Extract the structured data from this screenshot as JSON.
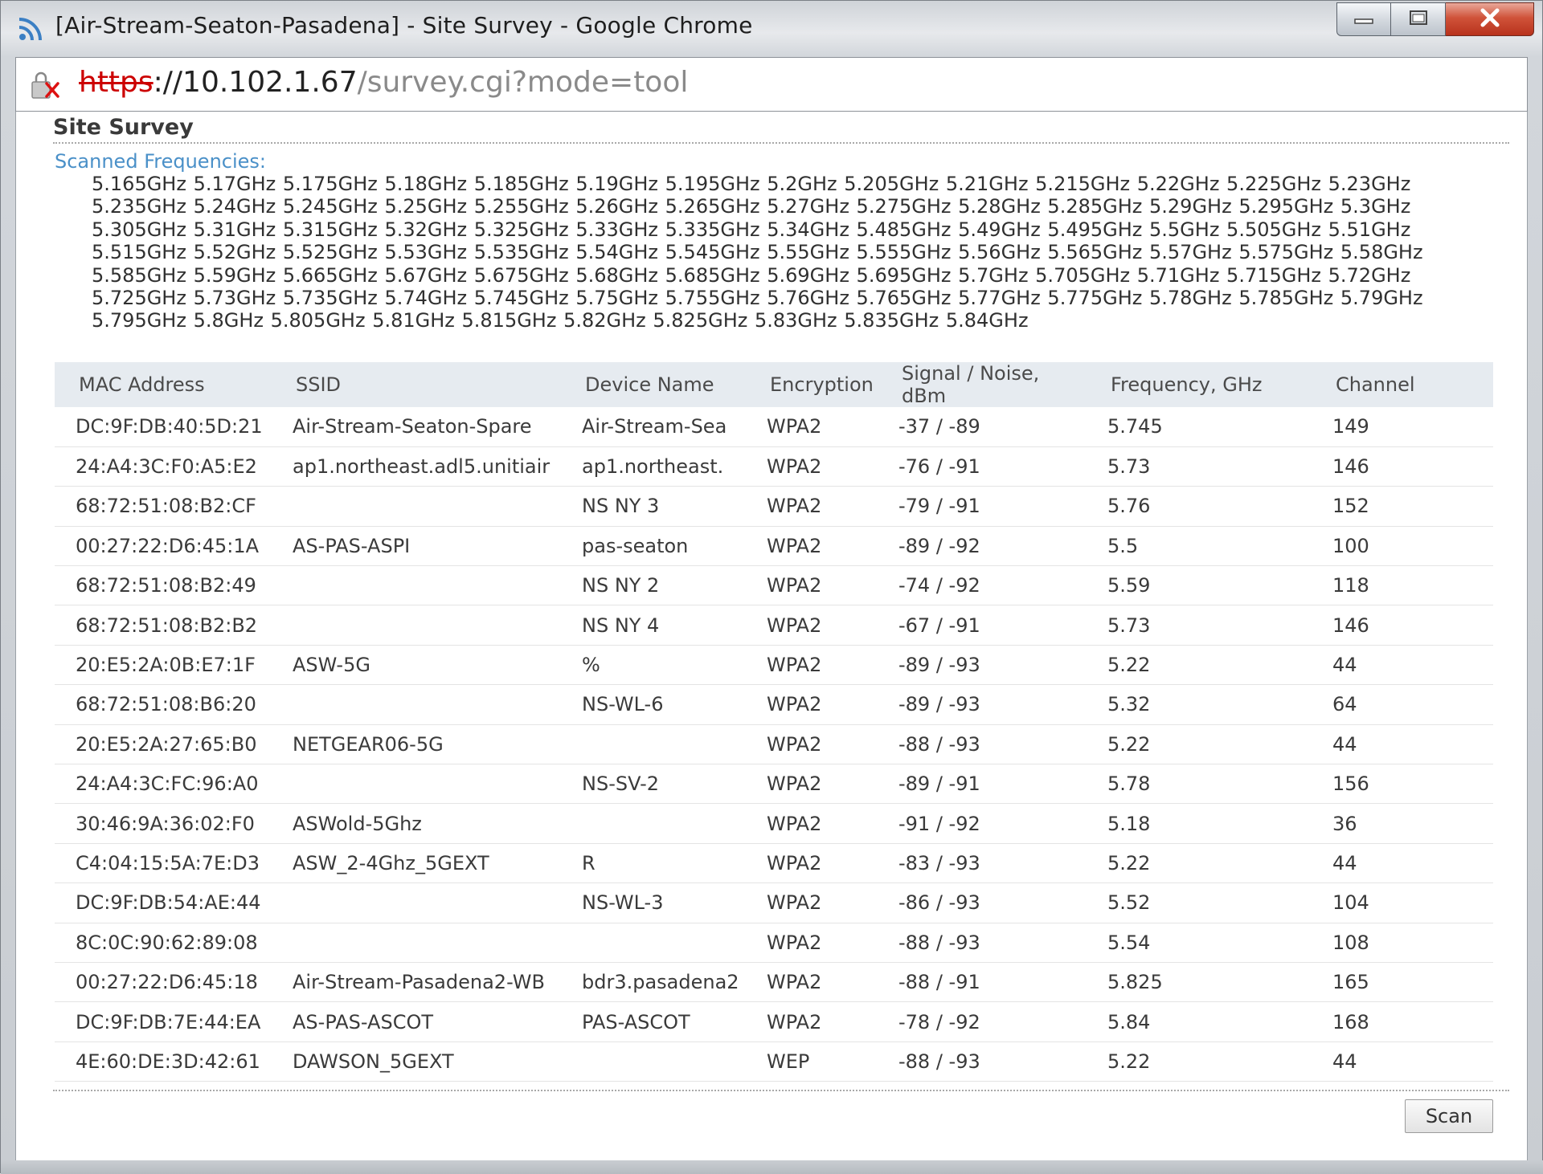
{
  "window": {
    "title": "[Air-Stream-Seaton-Pasadena] - Site Survey - Google Chrome",
    "icon": "rss-feed-icon",
    "controls": [
      "minimize-icon",
      "maximize-icon",
      "close-icon"
    ]
  },
  "address": {
    "scheme": "https",
    "host": "://10.102.1.67",
    "path": "/survey.cgi?mode=tool",
    "security_icon": "insecure-lock-icon"
  },
  "page": {
    "title": "Site Survey",
    "frequencies_label": "Scanned Frequencies:",
    "frequencies_text": "5.165GHz 5.17GHz 5.175GHz 5.18GHz 5.185GHz 5.19GHz 5.195GHz 5.2GHz 5.205GHz 5.21GHz 5.215GHz 5.22GHz 5.225GHz 5.23GHz 5.235GHz 5.24GHz 5.245GHz 5.25GHz 5.255GHz 5.26GHz 5.265GHz 5.27GHz 5.275GHz 5.28GHz 5.285GHz 5.29GHz 5.295GHz 5.3GHz 5.305GHz 5.31GHz 5.315GHz 5.32GHz 5.325GHz 5.33GHz 5.335GHz 5.34GHz 5.485GHz 5.49GHz 5.495GHz 5.5GHz 5.505GHz 5.51GHz 5.515GHz 5.52GHz 5.525GHz 5.53GHz 5.535GHz 5.54GHz 5.545GHz 5.55GHz 5.555GHz 5.56GHz 5.565GHz 5.57GHz 5.575GHz 5.58GHz 5.585GHz 5.59GHz 5.665GHz 5.67GHz 5.675GHz 5.68GHz 5.685GHz 5.69GHz 5.695GHz 5.7GHz 5.705GHz 5.71GHz 5.715GHz 5.72GHz 5.725GHz 5.73GHz 5.735GHz 5.74GHz 5.745GHz 5.75GHz 5.755GHz 5.76GHz 5.765GHz 5.77GHz 5.775GHz 5.78GHz 5.785GHz 5.79GHz 5.795GHz 5.8GHz 5.805GHz 5.81GHz 5.815GHz 5.82GHz 5.825GHz 5.83GHz 5.835GHz 5.84GHz",
    "scan_label": "Scan"
  },
  "table": {
    "columns": [
      "MAC Address",
      "SSID",
      "Device Name",
      "Encryption",
      "Signal / Noise, dBm",
      "Frequency, GHz",
      "Channel"
    ],
    "rows": [
      [
        "DC:9F:DB:40:5D:21",
        "Air-Stream-Seaton-Spare",
        "Air-Stream-Sea",
        "WPA2",
        "-37 / -89",
        "5.745",
        "149"
      ],
      [
        "24:A4:3C:F0:A5:E2",
        "ap1.northeast.adl5.unitiair",
        "ap1.northeast.",
        "WPA2",
        "-76 / -91",
        "5.73",
        "146"
      ],
      [
        "68:72:51:08:B2:CF",
        "",
        "NS NY 3",
        "WPA2",
        "-79 / -91",
        "5.76",
        "152"
      ],
      [
        "00:27:22:D6:45:1A",
        "AS-PAS-ASPI",
        "pas-seaton",
        "WPA2",
        "-89 / -92",
        "5.5",
        "100"
      ],
      [
        "68:72:51:08:B2:49",
        "",
        "NS NY 2",
        "WPA2",
        "-74 / -92",
        "5.59",
        "118"
      ],
      [
        "68:72:51:08:B2:B2",
        "",
        "NS NY 4",
        "WPA2",
        "-67 / -91",
        "5.73",
        "146"
      ],
      [
        "20:E5:2A:0B:E7:1F",
        "ASW-5G",
        "%",
        "WPA2",
        "-89 / -93",
        "5.22",
        "44"
      ],
      [
        "68:72:51:08:B6:20",
        "",
        "NS-WL-6",
        "WPA2",
        "-89 / -93",
        "5.32",
        "64"
      ],
      [
        "20:E5:2A:27:65:B0",
        "NETGEAR06-5G",
        "",
        "WPA2",
        "-88 / -93",
        "5.22",
        "44"
      ],
      [
        "24:A4:3C:FC:96:A0",
        "",
        "NS-SV-2",
        "WPA2",
        "-89 / -91",
        "5.78",
        "156"
      ],
      [
        "30:46:9A:36:02:F0",
        "ASWold-5Ghz",
        "",
        "WPA2",
        "-91 / -92",
        "5.18",
        "36"
      ],
      [
        "C4:04:15:5A:7E:D3",
        "ASW_2-4Ghz_5GEXT",
        "R",
        "WPA2",
        "-83 / -93",
        "5.22",
        "44"
      ],
      [
        "DC:9F:DB:54:AE:44",
        "",
        "NS-WL-3",
        "WPA2",
        "-86 / -93",
        "5.52",
        "104"
      ],
      [
        "8C:0C:90:62:89:08",
        "",
        "",
        "WPA2",
        "-88 / -93",
        "5.54",
        "108"
      ],
      [
        "00:27:22:D6:45:18",
        "Air-Stream-Pasadena2-WB",
        "bdr3.pasadena2",
        "WPA2",
        "-88 / -91",
        "5.825",
        "165"
      ],
      [
        "DC:9F:DB:7E:44:EA",
        "AS-PAS-ASCOT",
        "PAS-ASCOT",
        "WPA2",
        "-78 / -92",
        "5.84",
        "168"
      ],
      [
        "4E:60:DE:3D:42:61",
        "DAWSON_5GEXT",
        "",
        "WEP",
        "-88 / -93",
        "5.22",
        "44"
      ]
    ]
  },
  "colors": {
    "link_blue": "#4a90c8",
    "header_bg": "#e6ebf0",
    "insecure_red": "#cc0000"
  }
}
